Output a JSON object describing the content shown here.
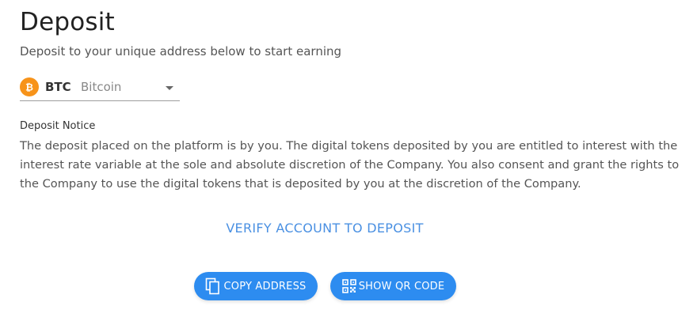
{
  "header": {
    "title": "Deposit",
    "subtitle": "Deposit to your unique address below to start earning"
  },
  "currency": {
    "code": "BTC",
    "name": "Bitcoin",
    "icon": "bitcoin-icon",
    "icon_color": "#f7931a"
  },
  "notice": {
    "heading": "Deposit Notice",
    "text": "The deposit placed on the platform is by you. The digital tokens deposited by you are entitled to interest with the interest rate variable at the sole and absolute discretion of the Company. You also consent and grant the rights to the Company to use the digital tokens that is deposited by you at the discretion of the Company."
  },
  "verify": {
    "label": "VERIFY ACCOUNT TO DEPOSIT",
    "color": "#4a90e2"
  },
  "actions": {
    "copy_label": "COPY ADDRESS",
    "copy_icon": "copy-icon",
    "qr_label": "SHOW QR CODE",
    "qr_icon": "qr-code-icon",
    "button_color": "#2d8cf0"
  }
}
